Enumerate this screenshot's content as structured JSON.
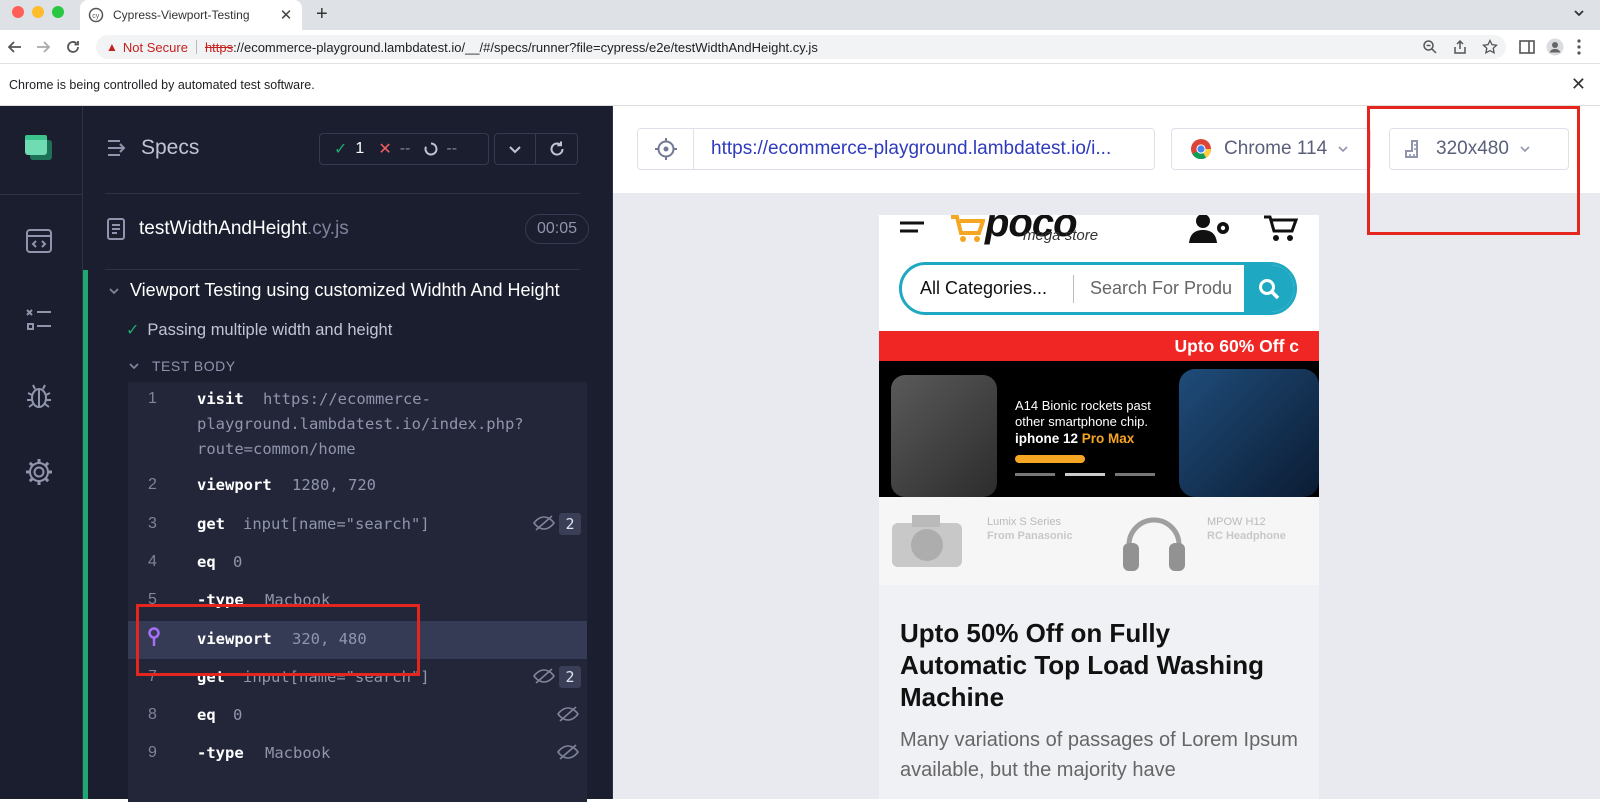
{
  "browser": {
    "tab_title": "Cypress-Viewport-Testing",
    "not_secure": "Not Secure",
    "url_scheme": "https",
    "url_rest": "://ecommerce-playground.lambdatest.io/__/#/specs/runner?file=cypress/e2e/testWidthAndHeight.cy.js",
    "info_message": "Chrome is being controlled by automated test software."
  },
  "reporter": {
    "specs_label": "Specs",
    "passed": "1",
    "failed": "--",
    "pending": "--",
    "file_name": "testWidthAndHeight",
    "file_ext": ".cy.js",
    "duration": "00:05",
    "suite_title": "Viewport Testing using customized Widhth And Height",
    "test_title": "Passing multiple width and height",
    "test_body_label": "TEST BODY",
    "commands": [
      {
        "num": "1",
        "name": "visit",
        "msg": "https://ecommerce-",
        "msg2": "playground.lambdatest.io/index.php?",
        "msg3": "route=common/home"
      },
      {
        "num": "2",
        "name": "viewport",
        "msg": "1280, 720"
      },
      {
        "num": "3",
        "name": "get",
        "msg": "input[name=\"search\"]",
        "count": "2"
      },
      {
        "num": "4",
        "name": "eq",
        "msg": "0"
      },
      {
        "num": "5",
        "name": "-type",
        "msg": "Macbook"
      },
      {
        "num": "",
        "name": "viewport",
        "msg": "320, 480"
      },
      {
        "num": "7",
        "name": "get",
        "msg": "input[name=\"search\"]",
        "count": "2"
      },
      {
        "num": "8",
        "name": "eq",
        "msg": "0"
      },
      {
        "num": "9",
        "name": "-type",
        "msg": "Macbook"
      }
    ]
  },
  "aut": {
    "url": "https://ecommerce-playground.lambdatest.io/i...",
    "browser": "Chrome 114",
    "viewport": "320x480"
  },
  "site": {
    "logo": "poco",
    "logo_sub": "mega store",
    "category": "All Categories...",
    "search_placeholder": "Search For Produ",
    "promo": "Upto 60% Off c",
    "hero_line1": "A14 Bionic rockets past",
    "hero_line2": "other smartphone chip.",
    "hero_model": "iphone 12",
    "hero_model_suffix": "Pro Max",
    "banner1_title": "Lumix S Series",
    "banner1_sub": "From Panasonic",
    "banner2_title": "MPOW H12",
    "banner2_sub": "RC Headphone",
    "article_title": "Upto 50% Off on Fully Automatic Top Load Washing Machine",
    "article_text": "Many variations of passages of Lorem Ipsum available, but the majority have"
  },
  "colors": {
    "pass_green": "#1fa971",
    "fail_red": "#f15e61",
    "highlight_red": "#e4261f",
    "cypress_dark": "#1b1e2e",
    "poco_teal": "#1fa8c1"
  }
}
